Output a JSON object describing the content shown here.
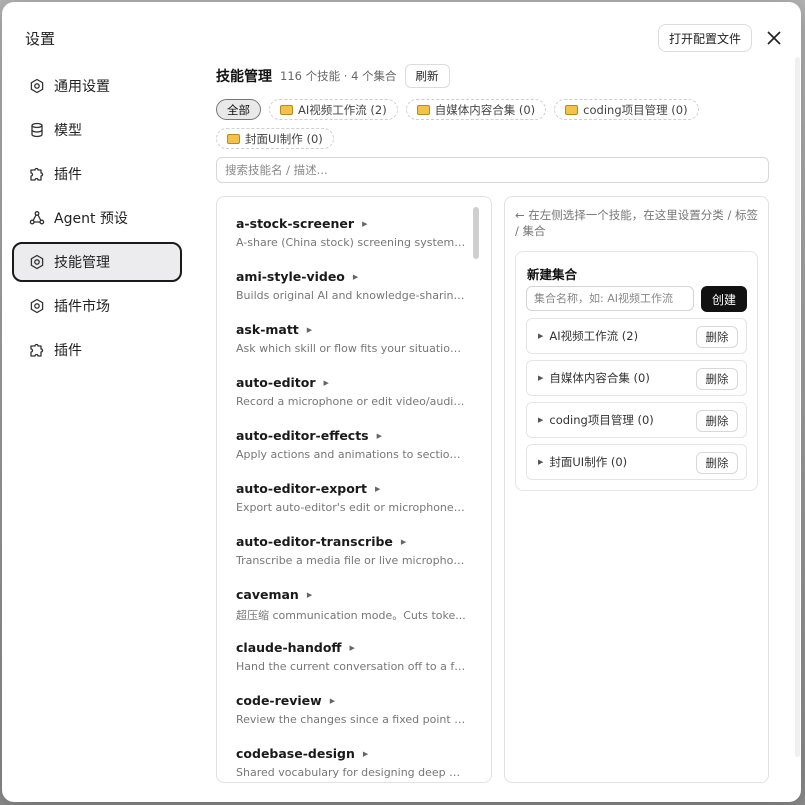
{
  "dialog": {
    "title": "设置",
    "open_config_label": "打开配置文件"
  },
  "sidebar": {
    "items": [
      {
        "label": "通用设置",
        "icon": "gear-icon"
      },
      {
        "label": "模型",
        "icon": "model-icon"
      },
      {
        "label": "插件",
        "icon": "puzzle-icon"
      },
      {
        "label": "Agent 预设",
        "icon": "agent-icon"
      },
      {
        "label": "技能管理",
        "icon": "gear-icon",
        "active": true
      },
      {
        "label": "插件市场",
        "icon": "gear-icon"
      },
      {
        "label": "插件",
        "icon": "puzzle-icon"
      }
    ]
  },
  "main": {
    "title": "技能管理",
    "meta": "116 个技能 · 4 个集合",
    "refresh_label": "刷新",
    "tags": [
      {
        "label": "全部",
        "active": true
      },
      {
        "label": "AI视频工作流 (2)"
      },
      {
        "label": "自媒体内容合集 (0)"
      },
      {
        "label": "coding项目管理 (0)"
      },
      {
        "label": "封面UI制作 (0)"
      }
    ],
    "search_placeholder": "搜索技能名 / 描述..."
  },
  "skills": [
    {
      "name": "a-stock-screener",
      "desc": "A-share (China stock) screening system u..."
    },
    {
      "name": "ami-style-video",
      "desc": "Builds original AI and knowledge-sharing..."
    },
    {
      "name": "ask-matt",
      "desc": "Ask which skill or flow fits your situation. ..."
    },
    {
      "name": "auto-editor",
      "desc": "Record a microphone or edit video/audio..."
    },
    {
      "name": "auto-editor-effects",
      "desc": "Apply actions and animations to sections..."
    },
    {
      "name": "auto-editor-export",
      "desc": "Export auto-editor's edit or microphone r..."
    },
    {
      "name": "auto-editor-transcribe",
      "desc": "Transcribe a media file or live microphon..."
    },
    {
      "name": "caveman",
      "desc": "超压缩 communication mode。Cuts toke..."
    },
    {
      "name": "claude-handoff",
      "desc": "Hand the current conversation off to a fr..."
    },
    {
      "name": "code-review",
      "desc": "Review the changes since a fixed point (c..."
    },
    {
      "name": "codebase-design",
      "desc": "Shared vocabulary for designing deep m..."
    }
  ],
  "right": {
    "hint": "← 在左侧选择一个技能，在这里设置分类 / 标签 / 集合",
    "new_collection_title": "新建集合",
    "input_placeholder": "集合名称，如: AI视频工作流",
    "create_label": "创建",
    "delete_label": "删除",
    "collections": [
      {
        "label": "AI视频工作流 (2)"
      },
      {
        "label": "自媒体内容合集 (0)"
      },
      {
        "label": "coding项目管理 (0)"
      },
      {
        "label": "封面UI制作 (0)"
      }
    ]
  }
}
